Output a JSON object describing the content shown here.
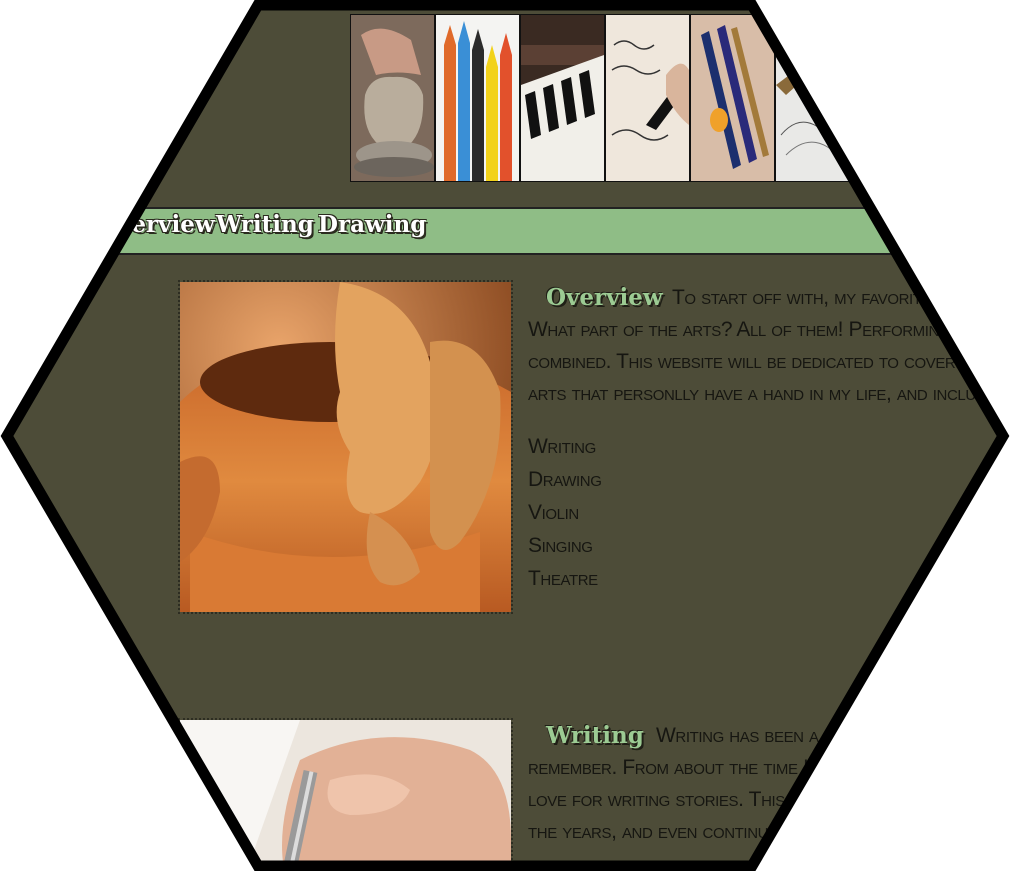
{
  "nav": {
    "items": [
      {
        "label": "Overview"
      },
      {
        "label": "Writing"
      },
      {
        "label": "Drawing"
      }
    ]
  },
  "banner": {
    "tiles": [
      "pottery-hands",
      "colored-pencils",
      "piano-keys",
      "handwriting-pen",
      "paint-brushes",
      "sketch"
    ]
  },
  "sections": [
    {
      "heading": "Overview",
      "lines": [
        "To start off with, my favorite th",
        "What part of the arts? All of them! Performing arts, a",
        "combined. This website will be dedicated to covering spec",
        "arts that personlly have a hand in my life, and include the"
      ],
      "list": [
        "Writing",
        "Drawing",
        "Violin",
        "Singing",
        "Theatre"
      ]
    },
    {
      "heading": "Writing",
      "lines": [
        "Writing has been a hu",
        "remember. From about the time I wa",
        "love for writing stories. This is a",
        "the years, and even continues t"
      ]
    }
  ],
  "colors": {
    "background": "#4d4c38",
    "navbar": "#8fbd86",
    "heading": "#9ccb93",
    "border": "#000000"
  }
}
